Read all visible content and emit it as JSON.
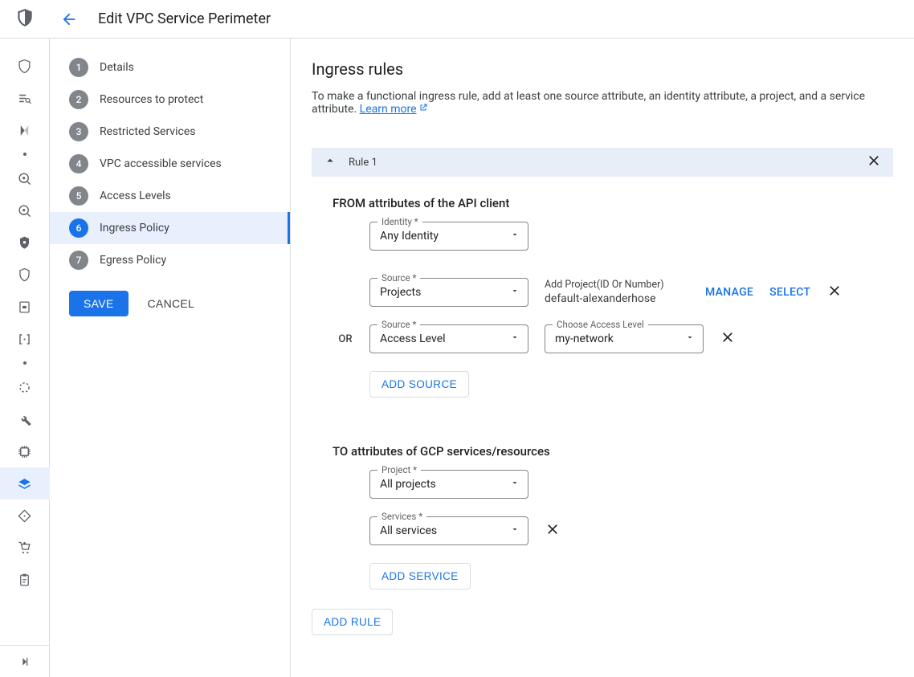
{
  "header": {
    "title": "Edit VPC Service Perimeter"
  },
  "steps": {
    "items": [
      {
        "num": "1",
        "label": "Details"
      },
      {
        "num": "2",
        "label": "Resources to protect"
      },
      {
        "num": "3",
        "label": "Restricted Services"
      },
      {
        "num": "4",
        "label": "VPC accessible services"
      },
      {
        "num": "5",
        "label": "Access Levels"
      },
      {
        "num": "6",
        "label": "Ingress Policy"
      },
      {
        "num": "7",
        "label": "Egress Policy"
      }
    ],
    "active_index": 5,
    "save_label": "SAVE",
    "cancel_label": "CANCEL"
  },
  "main": {
    "title": "Ingress rules",
    "desc_pre": "To make a functional ingress rule, add at least one source attribute, an identity attribute, a project, and a service attribute. ",
    "learn_more": "Learn more",
    "rule": {
      "name": "Rule 1",
      "from_heading": "FROM attributes of the API client",
      "to_heading": "TO attributes of GCP services/resources",
      "identity_label": "Identity *",
      "identity_value": "Any Identity",
      "source_label": "Source *",
      "source1_value": "Projects",
      "project_hint": "Add Project(ID Or Number)",
      "project_value": "default-alexanderhose",
      "manage_label": "MANAGE",
      "select_label": "SELECT",
      "or_label": "OR",
      "source2_value": "Access Level",
      "access_level_label": "Choose Access Level",
      "access_level_value": "my-network",
      "add_source_label": "ADD SOURCE",
      "project_label": "Project *",
      "project_select_value": "All projects",
      "services_label": "Services *",
      "services_value": "All services",
      "add_service_label": "ADD SERVICE",
      "add_rule_label": "ADD RULE"
    }
  }
}
